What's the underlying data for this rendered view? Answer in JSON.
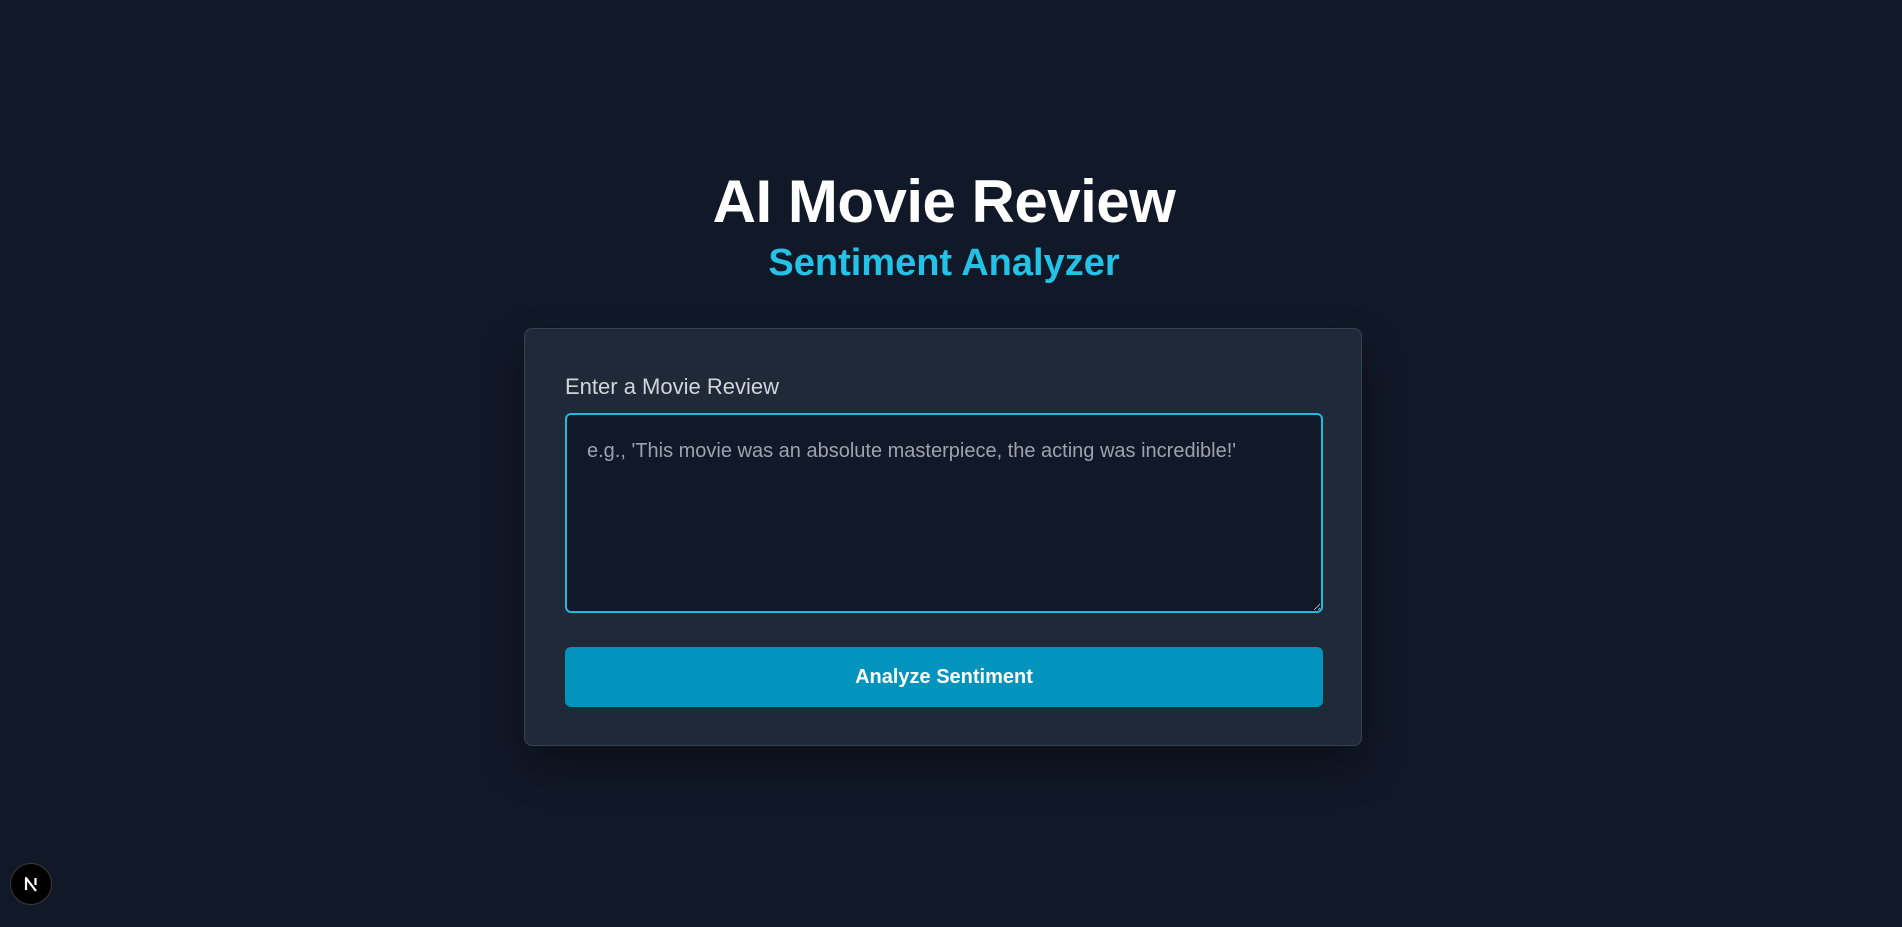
{
  "header": {
    "title": "AI Movie Review",
    "subtitle": "Sentiment Analyzer"
  },
  "form": {
    "label": "Enter a Movie Review",
    "review_value": "",
    "review_placeholder": "e.g., 'This movie was an absolute masterpiece, the acting was incredible!'",
    "submit_label": "Analyze Sentiment"
  },
  "dev_badge": {
    "icon": "nextjs-logo-icon"
  },
  "colors": {
    "background": "#111827",
    "card": "#1f2937",
    "accent": "#22c3e6",
    "button": "#0394bd",
    "input_border": "#22b8d9"
  }
}
